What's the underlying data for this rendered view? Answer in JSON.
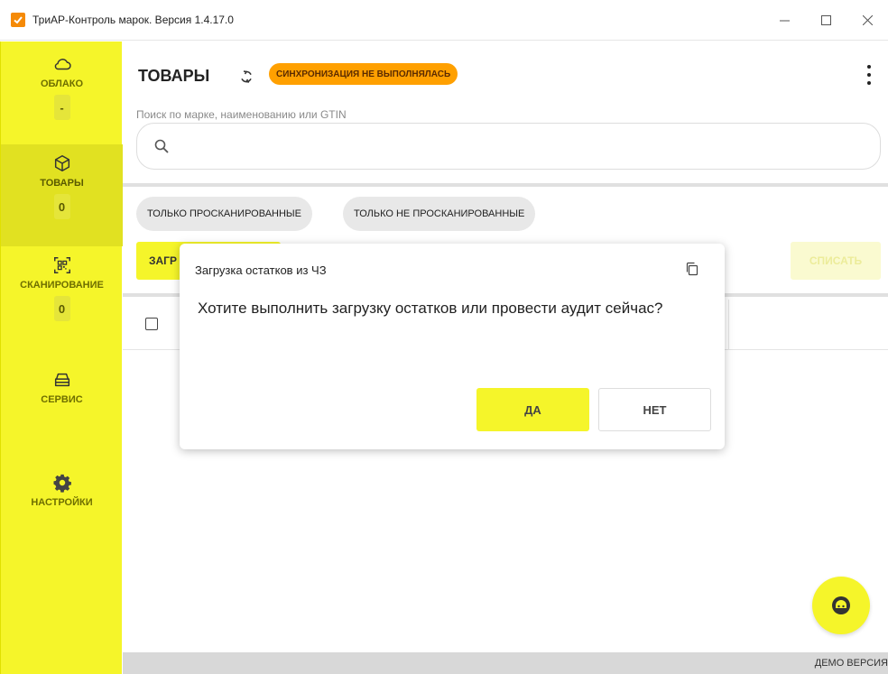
{
  "window": {
    "title": "ТриАР-Контроль марок. Версия 1.4.17.0",
    "minimize_symbol": "—",
    "maximize_symbol": "☐",
    "close_symbol": "✕"
  },
  "sidebar": {
    "items": [
      {
        "label": "ОБЛАКО",
        "icon": "cloud-icon",
        "badge": "-"
      },
      {
        "label": "ТОВАРЫ",
        "icon": "box-icon",
        "badge": "0"
      },
      {
        "label": "СКАНИРОВАНИЕ",
        "icon": "qr-scan-icon",
        "badge": "0"
      },
      {
        "label": "СЕРВИС",
        "icon": "cash-register-icon"
      },
      {
        "label": "НАСТРОЙКИ",
        "icon": "gear-icon"
      }
    ]
  },
  "header": {
    "title": "ТОВАРЫ",
    "sync_status": "СИНХРОНИЗАЦИЯ НЕ ВЫПОЛНЯЛАСЬ"
  },
  "search": {
    "label": "Поиск по марке, наименованию или GTIN",
    "value": "",
    "placeholder": ""
  },
  "filters": {
    "scanned_only": "ТОЛЬКО ПРОСКАНИРОВАННЫЕ",
    "not_scanned_only": "ТОЛЬКО НЕ ПРОСКАНИРОВАННЫЕ"
  },
  "actions": {
    "load_partial": "ЗАГР",
    "write_off": "СПИСАТЬ"
  },
  "footer": {
    "demo": "ДЕМО ВЕРСИЯ"
  },
  "dialog": {
    "title": "Загрузка остатков из ЧЗ",
    "message": "Хотите выполнить загрузку остатков или провести аудит сейчас?",
    "yes": "ДА",
    "no": "НЕТ"
  },
  "colors": {
    "accent": "#f5f52a",
    "sync_badge": "#ffa000",
    "app_icon": "#f58a07"
  }
}
